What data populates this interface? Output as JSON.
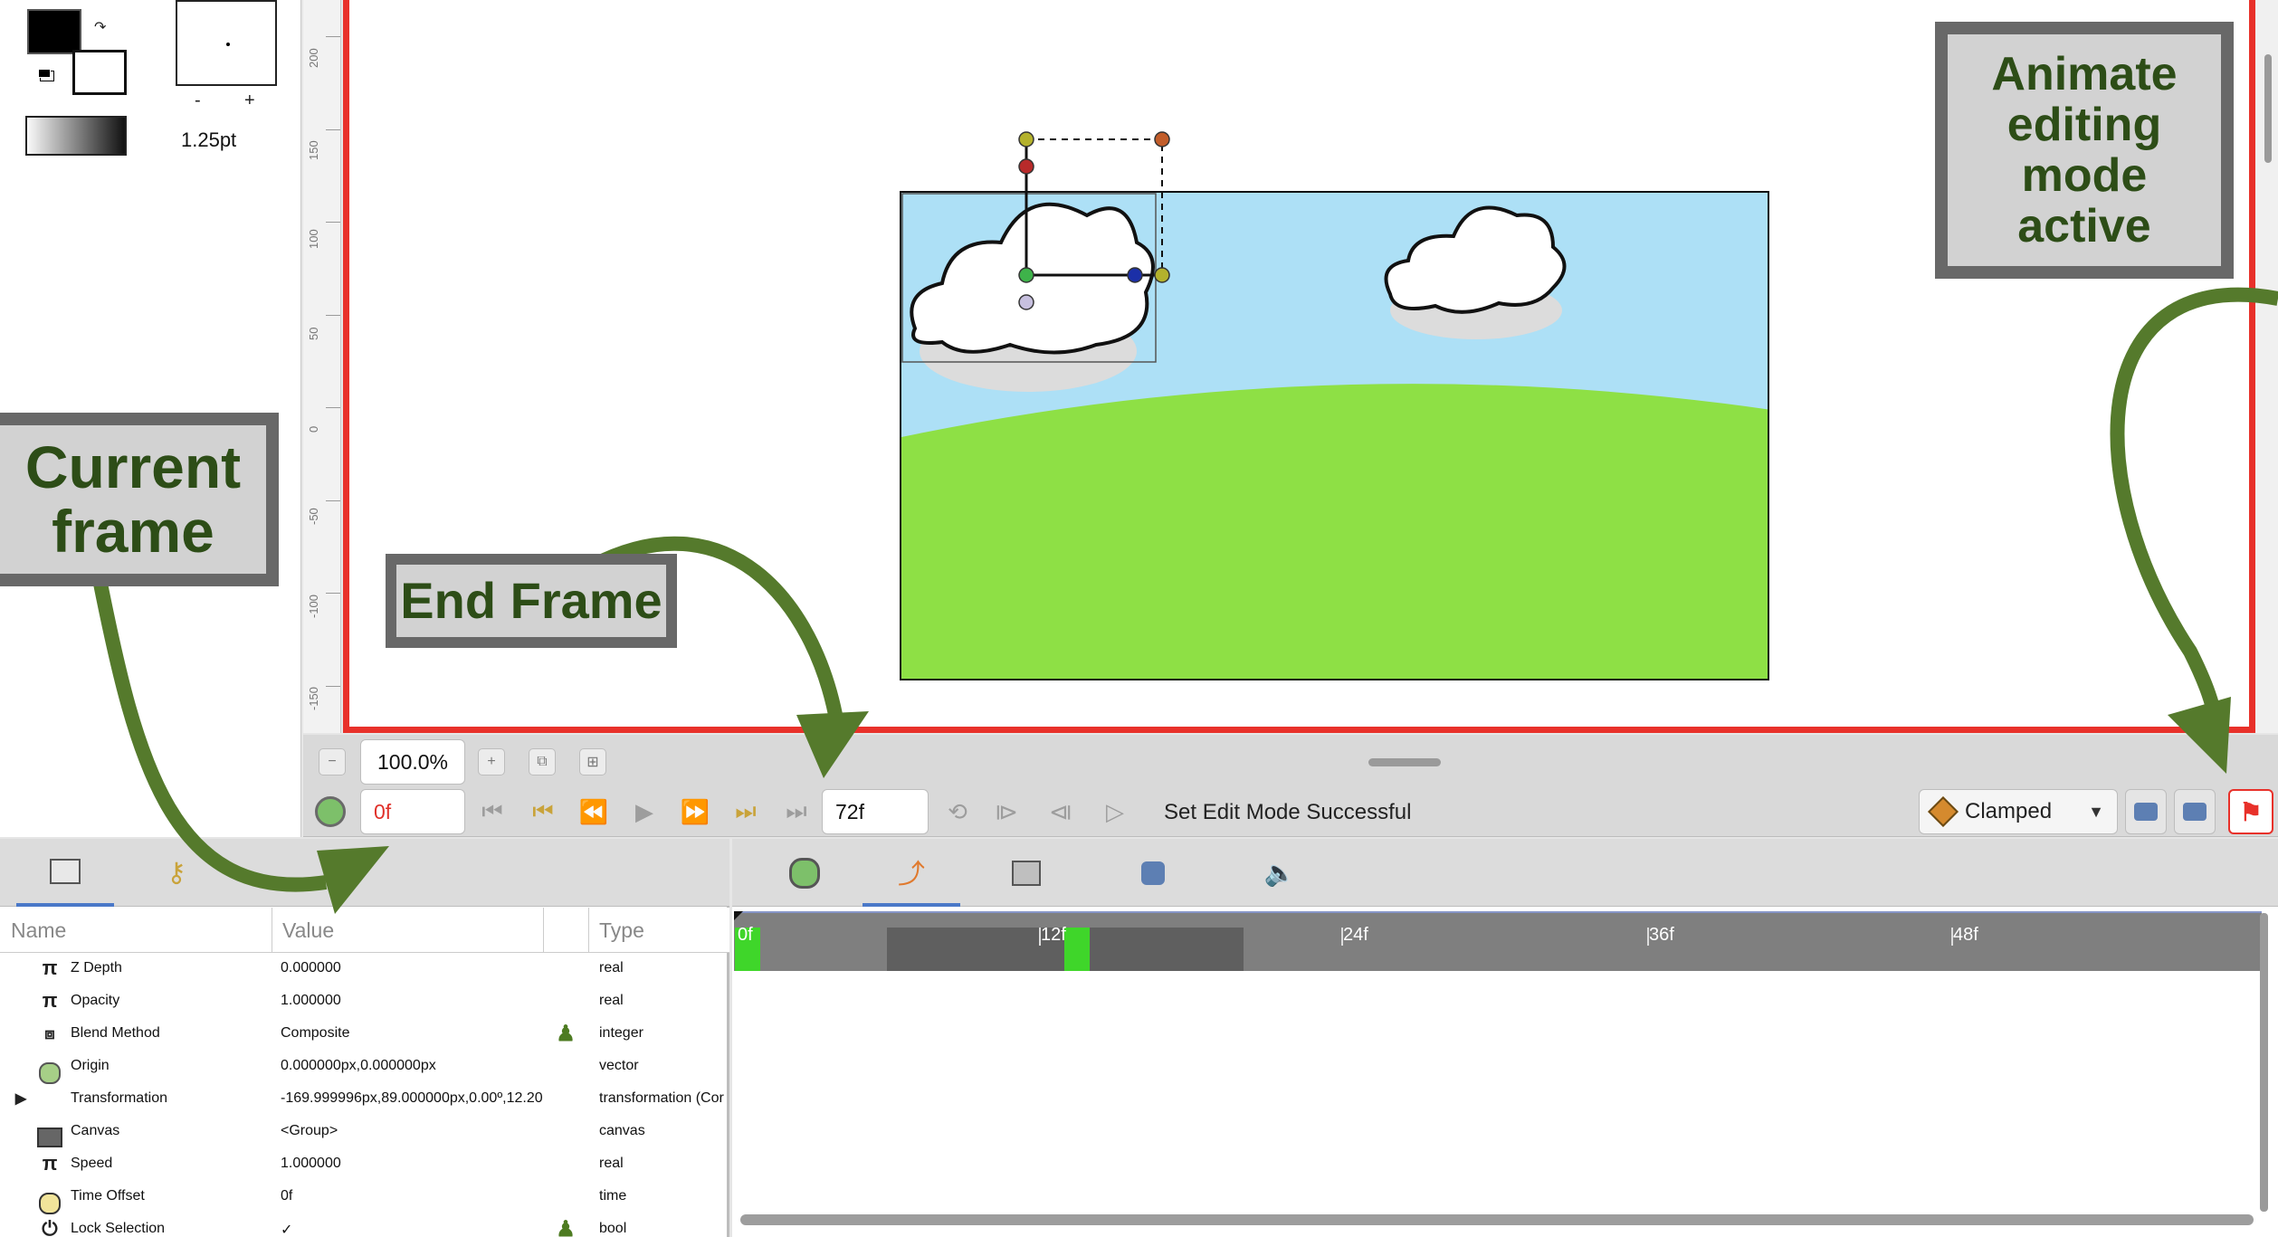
{
  "toolbox": {
    "brush_size": "1.25pt",
    "size_minus": "-",
    "size_plus": "+"
  },
  "ruler": {
    "labels": [
      "200",
      "150",
      "100",
      "50",
      "0",
      "-50",
      "-100",
      "-150"
    ]
  },
  "zoom": {
    "value": "100.0%"
  },
  "timebar": {
    "current_frame": "0f",
    "end_frame": "72f",
    "status": "Set Edit Mode Successful",
    "interpolation": "Clamped"
  },
  "params": {
    "columns": {
      "name": "Name",
      "value": "Value",
      "type": "Type"
    },
    "rows": [
      {
        "name": "Z Depth",
        "value": "0.000000",
        "type": "real",
        "icon": "pi-icon"
      },
      {
        "name": "Opacity",
        "value": "1.000000",
        "type": "real",
        "icon": "pi-icon"
      },
      {
        "name": "Blend Method",
        "value": "Composite",
        "type": "integer",
        "icon": "blend-icon"
      },
      {
        "name": "Origin",
        "value": "0.000000px,0.000000px",
        "type": "vector",
        "icon": "origin-icon"
      },
      {
        "name": "Transformation",
        "value": "-169.999996px,89.000000px,0.00º,12.20",
        "type": "transformation (Cor",
        "icon": ""
      },
      {
        "name": "Canvas",
        "value": "<Group>",
        "type": "canvas",
        "icon": "canvas-icon"
      },
      {
        "name": "Speed",
        "value": "1.000000",
        "type": "real",
        "icon": "pi-icon"
      },
      {
        "name": "Time Offset",
        "value": "0f",
        "type": "time",
        "icon": "clock-icon"
      },
      {
        "name": "Lock Selection",
        "value": "✓",
        "type": "bool",
        "icon": "power-icon"
      }
    ]
  },
  "timetrack": {
    "labels": [
      "0f",
      "12f",
      "24f",
      "36f",
      "48f"
    ]
  },
  "callouts": {
    "animate_mode": "Animate editing mode active",
    "current_frame": "Current frame",
    "end_frame": "End Frame"
  },
  "colors": {
    "animate_border": "#e8312a",
    "callout_text": "#2d4d17",
    "arrow": "#557a2c",
    "sky": "#ade0f6",
    "grass": "#8ee045",
    "keyframe": "#3fd62a"
  }
}
